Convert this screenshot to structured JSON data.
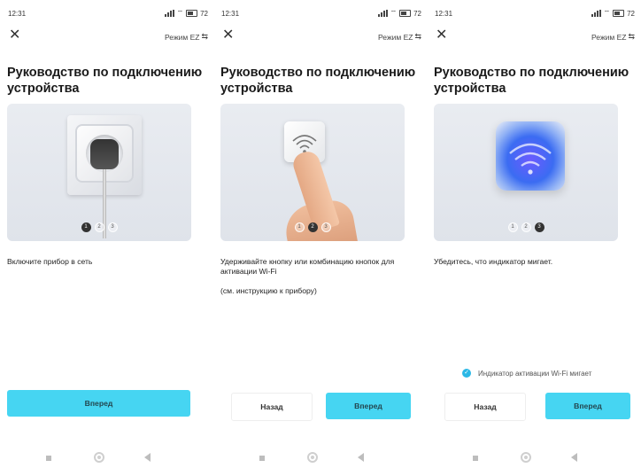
{
  "status_bar": {
    "time": "12:31",
    "battery": "72"
  },
  "header": {
    "close": "✕",
    "mode_label": "Режим EZ",
    "mode_icon": "⇆"
  },
  "title": "Руководство по подключению устройства",
  "screens": [
    {
      "dots": [
        "1",
        "2",
        "3"
      ],
      "active_dot": 1,
      "description": "Включите прибор в сеть",
      "next_label": "Вперед"
    },
    {
      "dots": [
        "1",
        "2",
        "3"
      ],
      "active_dot": 2,
      "description": "Удерживайте кнопку или комбинацию кнопок для активации Wi‑Fi",
      "note": "(см. инструкцию к прибору)",
      "back_label": "Назад",
      "next_label": "Вперед"
    },
    {
      "dots": [
        "1",
        "2",
        "3"
      ],
      "active_dot": 3,
      "description": "Убедитесь, что индикатор мигает.",
      "checkbox_label": "Индикатор активации Wi‑Fi мигает",
      "checkbox_checked": true,
      "back_label": "Назад",
      "next_label": "Вперед"
    }
  ],
  "colors": {
    "accent": "#46d5f2",
    "checkbox": "#2bb8e6"
  },
  "icons": [
    "close-icon",
    "swap-icon",
    "signal-icon",
    "wifi-icon",
    "battery-icon",
    "nav-recents-icon",
    "nav-home-icon",
    "nav-back-icon"
  ]
}
